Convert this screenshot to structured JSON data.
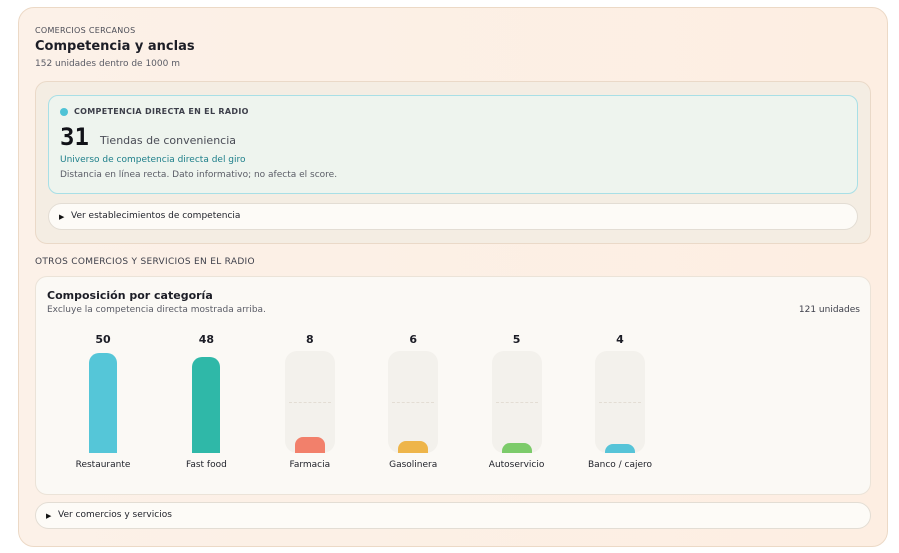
{
  "header": {
    "eyebrow": "COMERCIOS CERCANOS",
    "title": "Competencia y anclas",
    "subtitle": "152 unidades dentro de 1000 m"
  },
  "competition": {
    "eyebrow": "COMPETENCIA DIRECTA EN EL RADIO",
    "count": "31",
    "label": "Tiendas de conveniencia",
    "link": "Universo de competencia directa del giro",
    "note": "Distancia en línea recta. Dato informativo; no afecta el score.",
    "details_label": "Ver establecimientos de competencia",
    "dot_color": "#4fc3d6"
  },
  "others": {
    "heading": "OTROS COMERCIOS Y SERVICIOS EN EL RADIO",
    "card_title": "Composición por categoría",
    "card_subtitle": "Excluye la competencia directa mostrada arriba.",
    "total": "121 unidades",
    "details_label": "Ver comercios y servicios"
  },
  "chart_data": {
    "type": "bar",
    "categories": [
      "Restaurante",
      "Fast food",
      "Farmacia",
      "Gasolinera",
      "Autoservicio",
      "Banco / cajero"
    ],
    "values": [
      50,
      48,
      8,
      6,
      5,
      4
    ],
    "colors": [
      "#55c6d8",
      "#2fb8a8",
      "#f2806b",
      "#eeb54a",
      "#7ccb6a",
      "#56c4d8"
    ],
    "ylim": [
      0,
      50
    ]
  }
}
